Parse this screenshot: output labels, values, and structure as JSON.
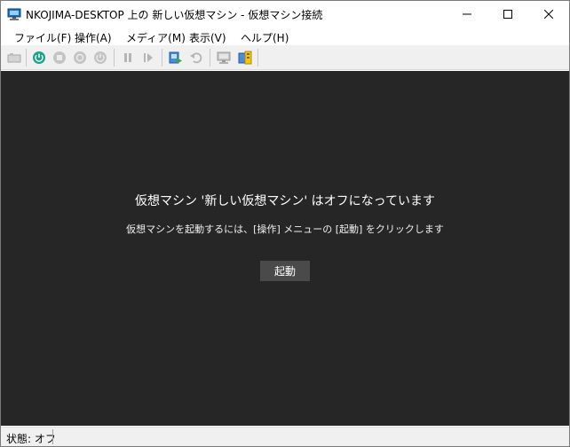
{
  "window": {
    "title": "NKOJIMA-DESKTOP 上の 新しい仮想マシン - 仮想マシン接続",
    "icon": "vm-connect-icon"
  },
  "menu": {
    "items": [
      {
        "label": "ファイル(F)"
      },
      {
        "label": "操作(A)"
      },
      {
        "label": "メディア(M)"
      },
      {
        "label": "表示(V)"
      },
      {
        "label": "ヘルプ(H)"
      }
    ]
  },
  "toolbar": {
    "icons": [
      "ctrl-alt-del-icon",
      "start-icon",
      "turn-off-icon",
      "shutdown-icon",
      "save-icon",
      "pause-icon",
      "resume-icon",
      "checkpoint-icon",
      "revert-icon",
      "enhanced-session-icon",
      "share-icon"
    ]
  },
  "display": {
    "title": "仮想マシン '新しい仮想マシン' はオフになっています",
    "hint": "仮想マシンを起動するには、[操作] メニューの [起動] をクリックします",
    "start_button": "起動"
  },
  "status": {
    "text": "状態: オフ"
  },
  "colors": {
    "display_bg": "#262626",
    "button_bg": "#4a4a4a",
    "accent_green": "#1aa18a"
  }
}
